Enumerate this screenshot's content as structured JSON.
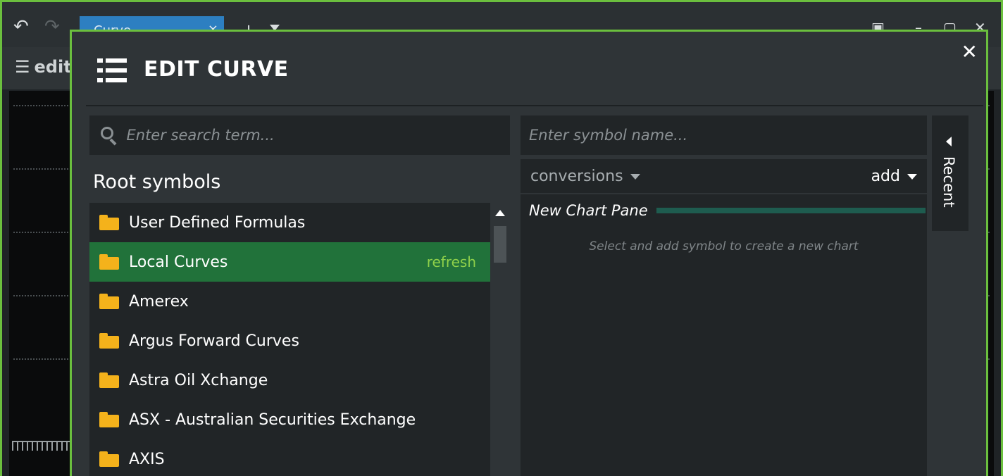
{
  "app": {
    "undo_icon": "undo-icon",
    "redo_icon": "redo-icon",
    "tab_label": "Curve",
    "tab_close": "×",
    "tab_add": "+",
    "toolbar_edit_label": "edit"
  },
  "modal": {
    "title": "EDIT CURVE",
    "close_label": "✕",
    "menu_icon": "list-icon",
    "search": {
      "placeholder": "Enter search term..."
    },
    "root_heading": "Root symbols",
    "root_items": [
      {
        "label": "User Defined Formulas",
        "action": ""
      },
      {
        "label": "Local Curves",
        "action": "refresh",
        "selected": true
      },
      {
        "label": "Amerex",
        "action": ""
      },
      {
        "label": "Argus Forward Curves",
        "action": ""
      },
      {
        "label": "Astra Oil Xchange",
        "action": ""
      },
      {
        "label": "ASX - Australian Securities Exchange",
        "action": ""
      },
      {
        "label": "AXIS",
        "action": ""
      }
    ],
    "symbol_input": {
      "placeholder": "Enter symbol name..."
    },
    "conversions_label": "conversions",
    "add_label": "add",
    "chart_pane_title": "New Chart Pane",
    "empty_hint": "Select and add symbol to create a new chart",
    "recent_label": "Recent"
  },
  "colors": {
    "accent_border": "#6bbf3e",
    "selected_row": "#21723a",
    "refresh_text": "#8fd04a",
    "folder": "#f4b21b",
    "chart_pane_bar": "#1e5c4f"
  }
}
